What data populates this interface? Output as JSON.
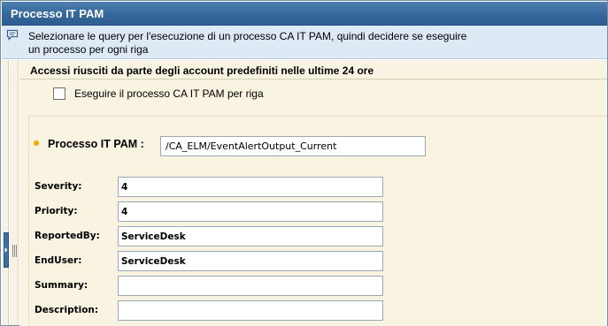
{
  "window": {
    "title": "Processo IT PAM"
  },
  "info": {
    "icon": "speech-bubble-icon",
    "line1": "Selezionare le query per l'esecuzione di un processo CA IT PAM, quindi decidere se eseguire",
    "line2": "un processo per ogni riga"
  },
  "section": {
    "title": "Accessi riusciti da parte degli account predefiniti nelle ultime 24 ore",
    "checkbox_label": "Eseguire il processo CA IT PAM per riga",
    "checkbox_checked": false
  },
  "process": {
    "label": "Processo IT PAM :",
    "value": "/CA_ELM/EventAlertOutput_Current"
  },
  "fields": [
    {
      "label": "Severity:",
      "value": "4"
    },
    {
      "label": "Priority:",
      "value": "4"
    },
    {
      "label": "ReportedBy:",
      "value": "ServiceDesk"
    },
    {
      "label": "EndUser:",
      "value": "ServiceDesk"
    },
    {
      "label": "Summary:",
      "value": ""
    },
    {
      "label": "Description:",
      "value": ""
    }
  ],
  "colors": {
    "titlebar": "#34669a",
    "infobar": "#dde9f5",
    "panel": "#f8f4e1",
    "required_marker": "#f0a800"
  }
}
